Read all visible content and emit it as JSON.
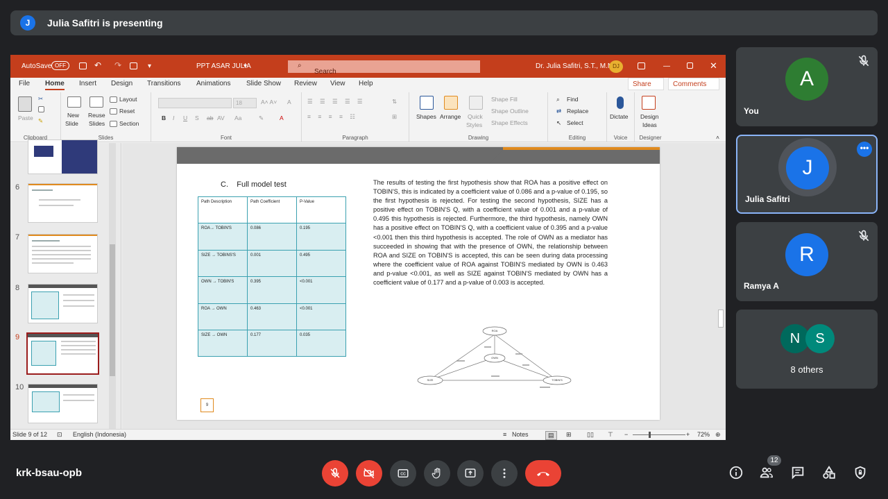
{
  "presenting": {
    "avatar_letter": "J",
    "text": "Julia Safitri is presenting"
  },
  "ppt": {
    "autosave": "AutoSave",
    "autosave_state": "OFF",
    "filename": "PPT ASAR JULIA",
    "search_placeholder": "Search",
    "user": "Dr. Julia Safitri, S.T., M.M.",
    "user_initials": "DJ",
    "tabs": [
      "File",
      "Home",
      "Insert",
      "Design",
      "Transitions",
      "Animations",
      "Slide Show",
      "Review",
      "View",
      "Help"
    ],
    "share": "Share",
    "comments": "Comments",
    "ribbon": {
      "paste": "Paste",
      "clipboard": "Clipboard",
      "new_slide_1": "New",
      "new_slide_2": "Slide",
      "reuse_1": "Reuse",
      "reuse_2": "Slides",
      "layout": "Layout",
      "reset": "Reset",
      "section": "Section",
      "slides": "Slides",
      "font_size": "18",
      "font": "Font",
      "paragraph": "Paragraph",
      "shapes": "Shapes",
      "arrange": "Arrange",
      "quick_1": "Quick",
      "quick_2": "Styles",
      "shape_fill": "Shape Fill",
      "shape_outline": "Shape Outline",
      "shape_effects": "Shape Effects",
      "drawing": "Drawing",
      "find": "Find",
      "replace": "Replace",
      "select": "Select",
      "editing": "Editing",
      "dictate": "Dictate",
      "voice": "Voice",
      "design_ideas_1": "Design",
      "design_ideas_2": "Ideas",
      "designer": "Designer"
    },
    "thumb_numbers": [
      "6",
      "7",
      "8",
      "9",
      "10"
    ],
    "status": {
      "slide": "Slide 9 of 12",
      "language": "English (Indonesia)",
      "notes": "Notes",
      "zoom": "72%"
    }
  },
  "slide": {
    "heading_letter": "C.",
    "heading": "Full model test",
    "table": {
      "headers": [
        "Path Description",
        "Path Coefficient",
        "P-Value"
      ],
      "rows": [
        [
          "ROA→ TOBIN'S",
          "0.086",
          "0.195"
        ],
        [
          "SIZE → TOBINS'S",
          "0.001",
          "0.495"
        ],
        [
          "OWN → TOBIN'S",
          "0.395",
          "<0.001"
        ],
        [
          "ROA → OWN",
          "0.463",
          "<0.001"
        ],
        [
          "SIZE → OWN",
          "0.177",
          "0.035"
        ]
      ]
    },
    "body": "The results of testing the first hypothesis show that ROA has a positive effect on TOBIN'S, this is indicated by a coefficient value of 0.086 and a p-value of 0.195, so the first hypothesis is rejected. For testing the second hypothesis, SIZE has a positive effect on TOBIN'S Q, with a coefficient value of 0.001 and a p-value of 0.495 this hypothesis is rejected. Furthermore, the third hypothesis, namely OWN has a positive effect on TOBIN'S Q, with a coefficient value of 0.395 and a p-value <0.001 then this third hypothesis is accepted. The role of OWN as a mediator has succeeded in showing that with the presence of OWN, the relationship between ROA and SIZE on TOBIN'S is accepted, this can be seen during data processing where the coefficient value of ROA against TOBIN'S mediated by OWN is 0.463 and p-value <0.001, as well as SIZE against TOBIN'S mediated by OWN has a coefficient value of 0.177 and a p-value of 0.003 is accepted.",
    "page_number": "9",
    "diagram": {
      "roa": "ROA",
      "own": "OWN",
      "size": "SIZE",
      "tobins": "TOBIN'S"
    }
  },
  "participants": [
    {
      "letter": "A",
      "name": "You",
      "color": "#2e7d32"
    },
    {
      "letter": "J",
      "name": "Julia Safitri",
      "color": "#1a73e8"
    },
    {
      "letter": "R",
      "name": "Ramya A",
      "color": "#1a73e8"
    }
  ],
  "others": {
    "letters": [
      "N",
      "S"
    ],
    "colors": [
      "#00695c",
      "#00897b"
    ],
    "label": "8 others"
  },
  "meeting_code": "krk-bsau-opb",
  "participant_count": "12"
}
